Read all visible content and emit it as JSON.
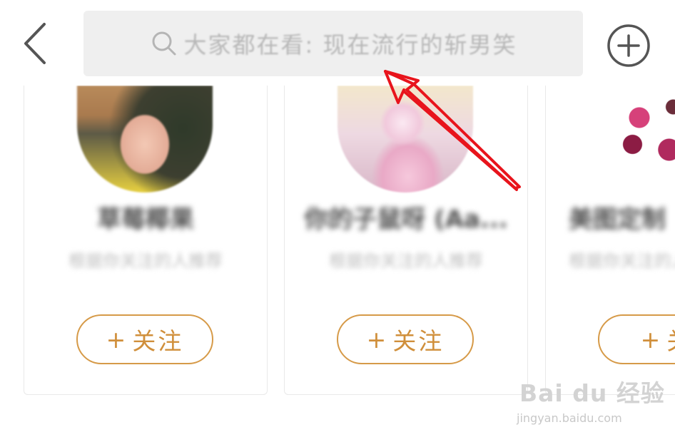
{
  "search": {
    "placeholder": "大家都在看: 现在流行的斩男笑"
  },
  "icons": {
    "back": "chevron-left-icon",
    "search": "search-icon",
    "add": "plus-circle-icon",
    "annotation": "red-arrow-annotation"
  },
  "cards": [
    {
      "name": "草莓椰果",
      "desc": "根据你关注的人推荐",
      "follow_label": "关注",
      "follow_plus": "+"
    },
    {
      "name": "你的子鼠呀 (Aa...",
      "desc": "根据你关注的人推荐",
      "follow_label": "关注",
      "follow_plus": "+"
    },
    {
      "name": "美图定制",
      "desc": "根据你关注的人推荐",
      "follow_label": "关",
      "follow_plus": "+"
    }
  ],
  "watermark": {
    "logo": "Bai du 经验",
    "url": "jingyan.baidu.com"
  },
  "colors": {
    "accent": "#d69a48",
    "search_bg": "#efefef",
    "annotation": "#e8141c"
  }
}
